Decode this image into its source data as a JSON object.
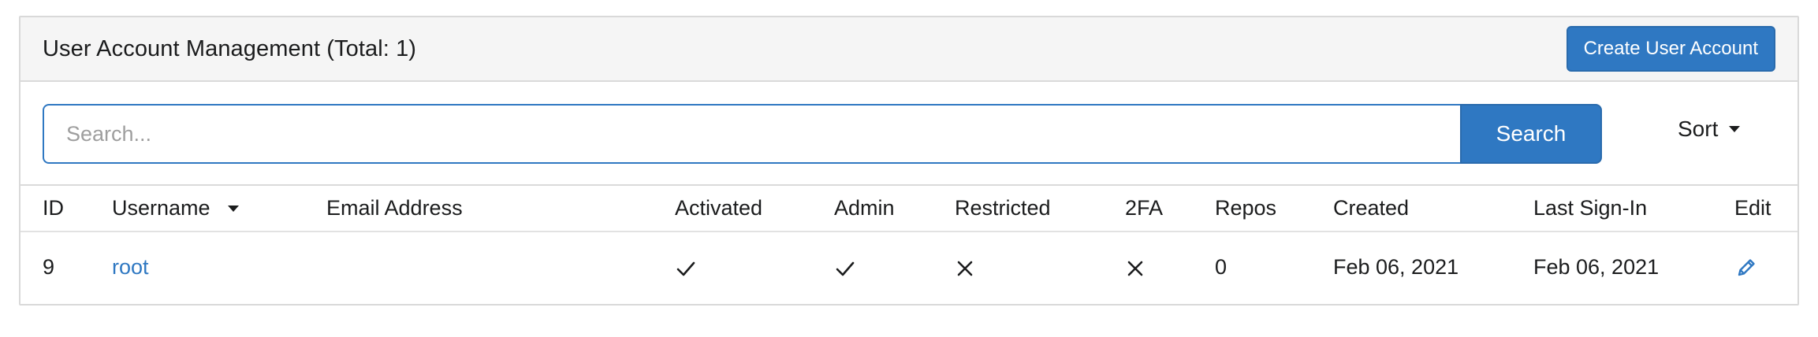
{
  "header": {
    "title": "User Account Management (Total: 1)",
    "create_button_label": "Create User Account"
  },
  "search": {
    "placeholder": "Search...",
    "value": "",
    "button_label": "Search"
  },
  "sort": {
    "label": "Sort"
  },
  "table": {
    "columns": {
      "id": "ID",
      "username": "Username",
      "email": "Email Address",
      "activated": "Activated",
      "admin": "Admin",
      "restricted": "Restricted",
      "twofa": "2FA",
      "repos": "Repos",
      "created": "Created",
      "last_signin": "Last Sign-In",
      "edit": "Edit"
    },
    "rows": [
      {
        "id": "9",
        "username": "root",
        "email": "",
        "activated": "check-icon",
        "admin": "check-icon",
        "restricted": "x-icon",
        "twofa": "x-icon",
        "repos": "0",
        "created": "Feb 06, 2021",
        "last_signin": "Feb 06, 2021",
        "edit": "pencil-icon"
      }
    ]
  },
  "colors": {
    "primary": "#2f78c2",
    "header_bg": "#f5f5f5",
    "border": "#d9d9d9"
  }
}
